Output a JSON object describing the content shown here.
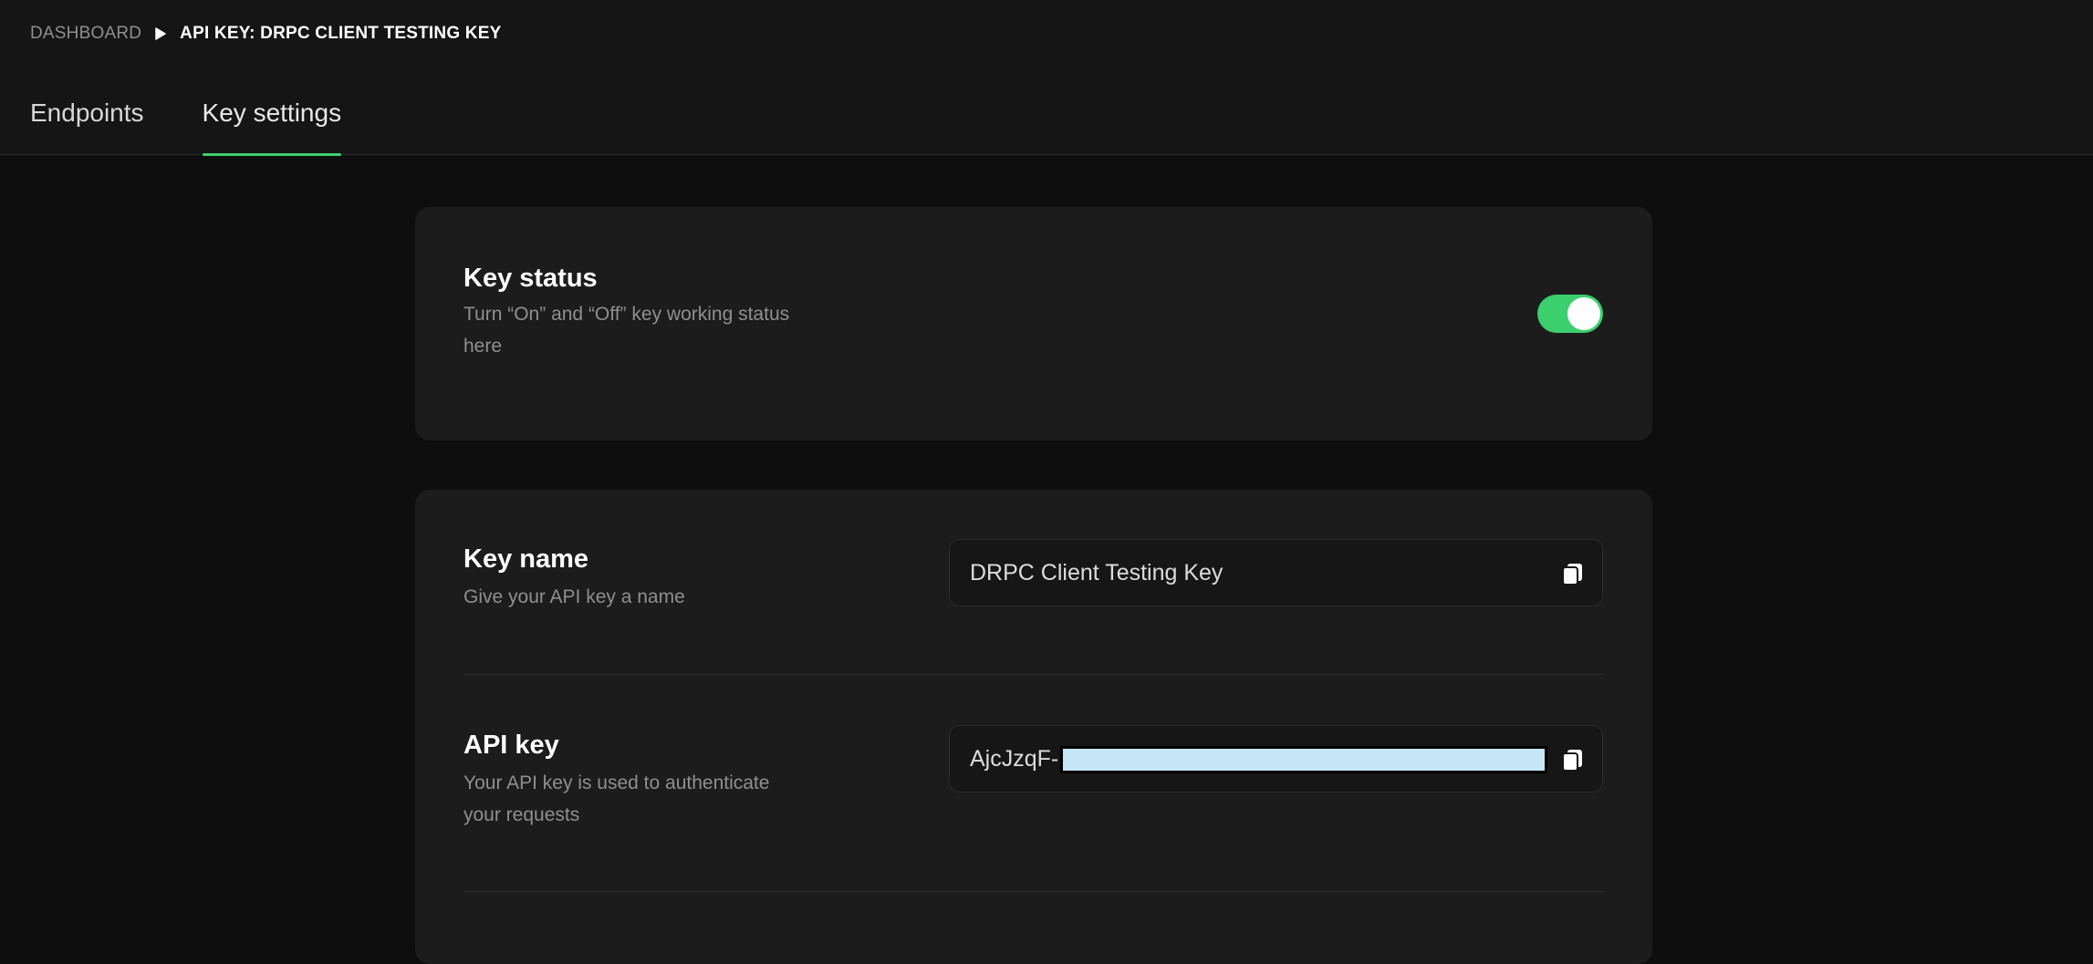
{
  "breadcrumb": {
    "root": "DASHBOARD",
    "current": "API KEY: DRPC CLIENT TESTING KEY"
  },
  "tabs": [
    {
      "label": "Endpoints",
      "active": false
    },
    {
      "label": "Key settings",
      "active": true
    }
  ],
  "key_status": {
    "title": "Key status",
    "description_line1": "Turn “On” and “Off” key working status",
    "description_line2": "here",
    "enabled": true
  },
  "key_name": {
    "title": "Key name",
    "description": "Give your API key a name",
    "value": "DRPC Client Testing Key"
  },
  "api_key": {
    "title": "API key",
    "description_line1": "Your API key is used to authenticate",
    "description_line2": "your requests",
    "value_prefix": "AjcJzqF-"
  },
  "colors": {
    "accent": "#3ccf6e",
    "card_bg": "#1c1c1c",
    "page_bg": "#0e0e0e",
    "masked_fill": "#c6e6f8"
  },
  "icons": {
    "breadcrumb_separator": "play-arrow-icon",
    "copy": "copy-icon"
  }
}
